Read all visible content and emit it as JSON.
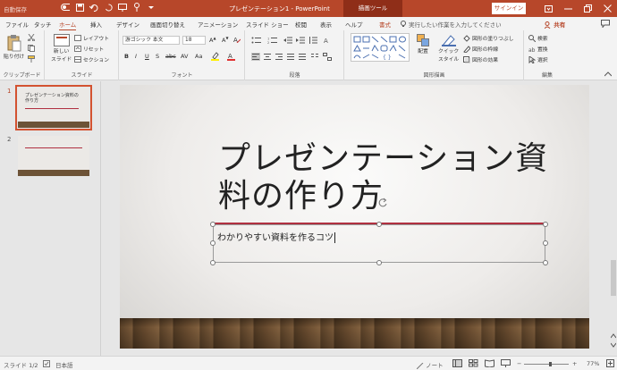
{
  "titlebar": {
    "autosave": "自動保存",
    "doc_title": "プレゼンテーション1 - PowerPoint",
    "context_tool": "描画ツール",
    "signin": "サインイン"
  },
  "tabs": {
    "items": [
      "ファイル",
      "タッチ",
      "ホーム",
      "挿入",
      "デザイン",
      "画面切り替え",
      "アニメーション",
      "スライド ショー",
      "校閲",
      "表示",
      "ヘルプ",
      "書式"
    ],
    "active": "ホーム",
    "tell_me": "実行したい作業を入力してください",
    "share": "共有"
  },
  "ribbon": {
    "clipboard": {
      "paste": "貼り付け",
      "label": "クリップボード"
    },
    "slides": {
      "new_slide_1": "新しい",
      "new_slide_2": "スライド",
      "layout": "レイアウト",
      "reset": "リセット",
      "section": "セクション",
      "label": "スライド"
    },
    "font": {
      "font_name": "游ゴシック 本文",
      "font_size": "18",
      "label": "フォント"
    },
    "paragraph": {
      "label": "段落"
    },
    "drawing": {
      "arrange": "配置",
      "quick_styles_1": "クイック",
      "quick_styles_2": "スタイル",
      "shape_fill": "図形の塗りつぶし",
      "shape_outline": "図形の枠線",
      "shape_effects": "図形の効果",
      "label": "図形描画"
    },
    "editing": {
      "find": "検索",
      "replace": "置換",
      "select": "選択",
      "label": "編集"
    }
  },
  "thumbnails": [
    {
      "number": "1",
      "title": "プレゼンテーション資料の作り方",
      "selected": true
    },
    {
      "number": "2",
      "title": "",
      "selected": false
    }
  ],
  "slide": {
    "title": "プレゼンテーション資料の作り方",
    "subtitle": "わかりやすい資料を作るコツ"
  },
  "status": {
    "slide_count": "スライド 1/2",
    "language": "日本語",
    "notes": "ノート",
    "zoom": "77%"
  },
  "colors": {
    "accent": "#b7472a",
    "title_line": "#b03040"
  }
}
